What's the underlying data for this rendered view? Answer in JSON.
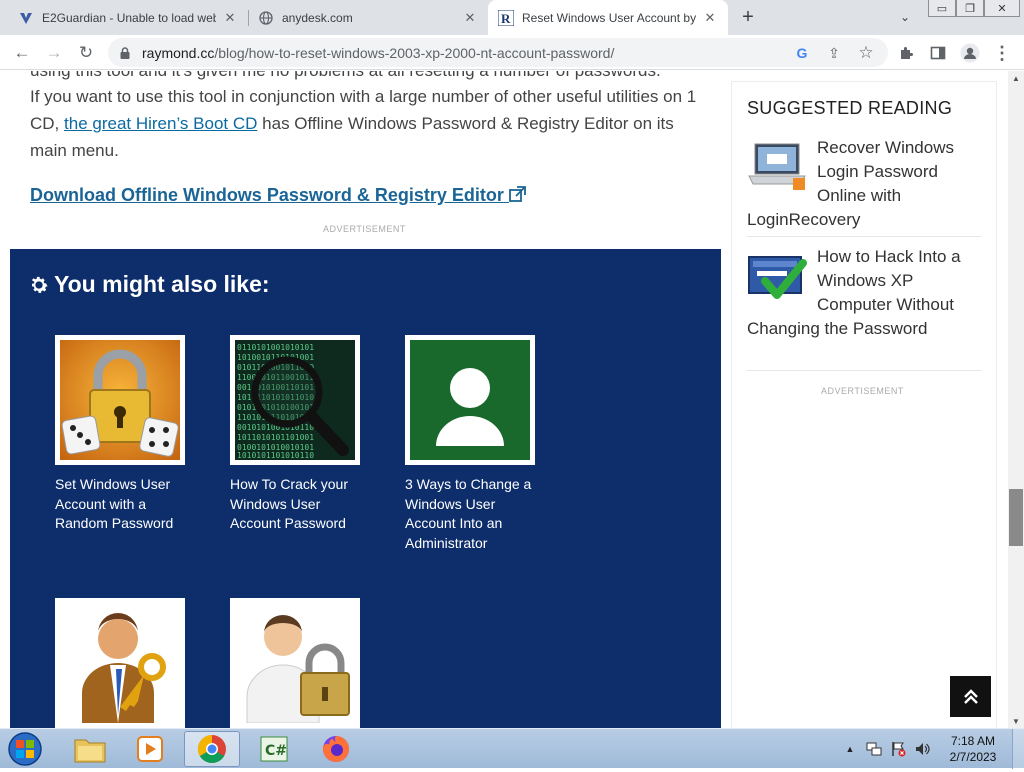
{
  "tabs": [
    {
      "title": "E2Guardian - Unable to load web",
      "close": "✕"
    },
    {
      "title": "anydesk.com",
      "close": "✕"
    },
    {
      "title": "Reset Windows User Account by",
      "close": "✕"
    }
  ],
  "tabstrip": {
    "new_tab": "+",
    "tab_search": "⌄"
  },
  "window_controls": {
    "minimize": "▭",
    "maximize": "❐",
    "close": "✕"
  },
  "toolbar": {
    "back": "←",
    "forward": "→",
    "reload": "↻",
    "url_host": "raymond.cc",
    "url_path": "/blog/how-to-reset-windows-2003-xp-2000-nt-account-password/",
    "google": "G",
    "share": "⇪",
    "bookmark": "☆",
    "extensions": "✚",
    "side_panel": "▣",
    "menu": "⋮"
  },
  "article": {
    "line_partial": "using this tool and it's given me no problems at all resetting a number of passwords.",
    "para_before_link": "If you want to use this tool in conjunction with a large number of other useful utilities on 1 CD,",
    "link_text": "the great Hiren’s Boot CD",
    "para_after_link": "has Offline Windows Password & Registry Editor on its main menu.",
    "download_label": "Download Offline Windows Password & Registry Editor",
    "ad_label": "ADVERTISEMENT"
  },
  "you_might_also_like": {
    "title": "You might also like:",
    "cards": [
      {
        "label": "Set Windows User Account with a Random Password"
      },
      {
        "label": "How To Crack your Windows User Account Password"
      },
      {
        "label": "3 Ways to Change a Windows User Account Into an Administrator"
      },
      {
        "label": ""
      },
      {
        "label": ""
      }
    ]
  },
  "sidebar": {
    "title": "SUGGESTED READING",
    "items": [
      {
        "label": "Recover Windows Login Password Online with LoginRecovery"
      },
      {
        "label": "How to Hack Into a Windows XP Computer Without Changing the Password"
      }
    ],
    "ad_label": "ADVERTISEMENT"
  },
  "back_to_top": "⌃",
  "taskbar": {
    "time": "7:18 AM",
    "date": "2/7/2023",
    "tray_arrow": "▲"
  },
  "colors": {
    "panel_blue": "#0d2d6b",
    "link_blue": "#1a6496",
    "tab_strip": "#dee1e6"
  }
}
